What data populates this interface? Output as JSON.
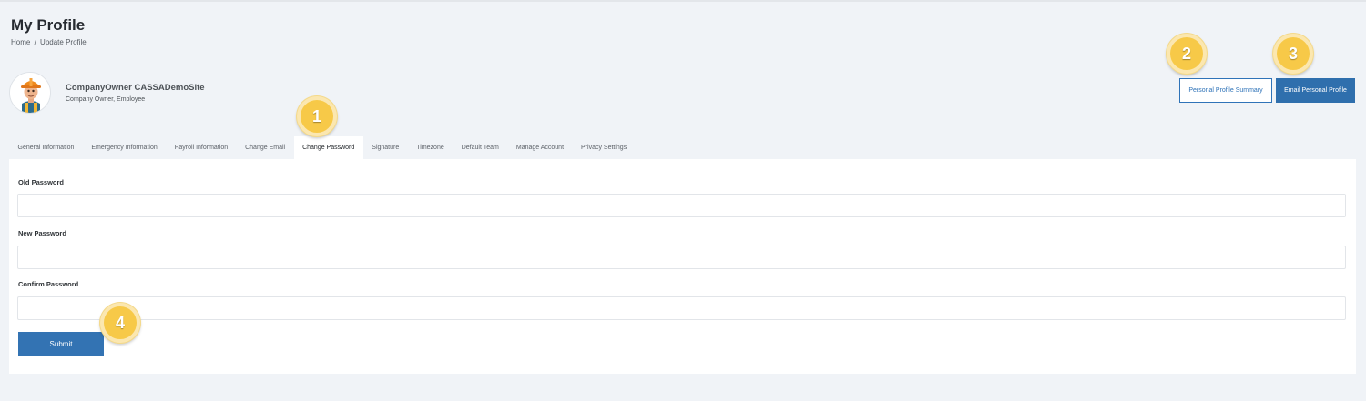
{
  "header": {
    "title": "My Profile",
    "breadcrumb": [
      "Home",
      "/",
      "Update Profile"
    ]
  },
  "profile": {
    "name": "CompanyOwner CASSADemoSite",
    "roles": "Company Owner, Employee",
    "avatar_icon": "worker-avatar-icon"
  },
  "actions": {
    "summary_label": "Personal Profile Summary",
    "email_label": "Email Personal Profile"
  },
  "tabs": [
    {
      "label": "General Information",
      "active": false
    },
    {
      "label": "Emergency Information",
      "active": false
    },
    {
      "label": "Payroll Information",
      "active": false
    },
    {
      "label": "Change Email",
      "active": false
    },
    {
      "label": "Change Password",
      "active": true
    },
    {
      "label": "Signature",
      "active": false
    },
    {
      "label": "Timezone",
      "active": false
    },
    {
      "label": "Default Team",
      "active": false
    },
    {
      "label": "Manage Account",
      "active": false
    },
    {
      "label": "Privacy Settings",
      "active": false
    }
  ],
  "form": {
    "old_password_label": "Old Password",
    "old_password_value": "",
    "new_password_label": "New Password",
    "new_password_value": "",
    "confirm_password_label": "Confirm Password",
    "confirm_password_value": "",
    "submit_label": "Submit"
  },
  "markers": [
    "1",
    "2",
    "3",
    "4"
  ],
  "colors": {
    "primary": "#2f6fad",
    "marker": "#f7c948",
    "background": "#f0f3f7"
  }
}
